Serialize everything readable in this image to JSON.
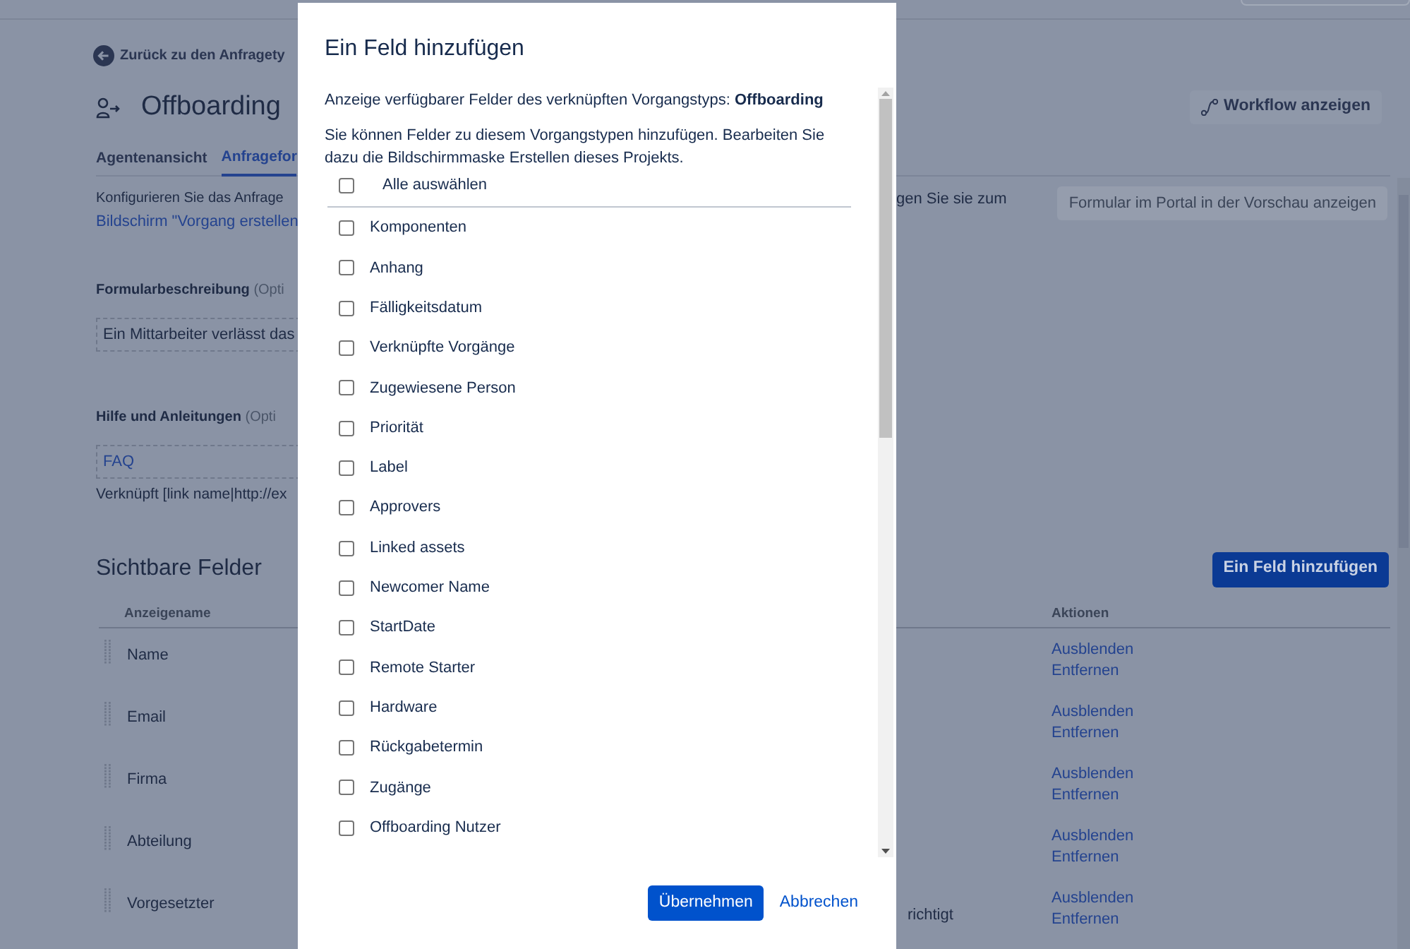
{
  "page": {
    "back_link": "Zurück zu den Anfragety",
    "title": "Offboarding",
    "workflow_button": "Workflow anzeigen",
    "tabs": [
      {
        "label": "Agentenansicht",
        "selected": false
      },
      {
        "label": "Anfragefor",
        "selected": true
      }
    ],
    "intro": {
      "text": "Konfigurieren Sie das Anfrage",
      "link": "Bildschirm \"Vorgang erstellen",
      "continuation": "gen Sie sie zum"
    },
    "preview_button": "Formular im Portal in der Vorschau anzeigen",
    "form_description": {
      "label": "Formularbeschreibung",
      "hint": "(Opti",
      "value": "Ein Mittarbeiter verlässt das"
    },
    "help": {
      "label": "Hilfe und Anleitungen",
      "hint": "(Opti",
      "value": "FAQ",
      "note": "Verknüpft [link name|http://ex"
    },
    "visible_fields": {
      "title": "Sichtbare Felder",
      "add_button": "Ein Feld hinzufügen",
      "columns": [
        "Anzeigename",
        "Aktionen"
      ],
      "rows": [
        {
          "name": "Name",
          "actions": [
            "Ausblenden",
            "Entfernen"
          ]
        },
        {
          "name": "Email",
          "actions": [
            "Ausblenden",
            "Entfernen"
          ]
        },
        {
          "name": "Firma",
          "actions": [
            "Ausblenden",
            "Entfernen"
          ]
        },
        {
          "name": "Abteilung",
          "actions": [
            "Ausblenden",
            "Entfernen"
          ]
        },
        {
          "name": "Vorgesetzter",
          "column_2": "richtigt",
          "actions": [
            "Ausblenden",
            "Entfernen"
          ]
        }
      ]
    }
  },
  "dialog": {
    "title": "Ein Feld hinzufügen",
    "info": "Anzeige verfügbarer Felder des verknüpften Vorgangstyps: **Offboarding**",
    "hint": "Sie können Felder zu diesem Vorgangstypen hinzufügen. Bearbeiten Sie dazu die Bildschirmmaske Erstellen dieses Projekts.",
    "select_all": {
      "label": "Alle auswählen",
      "checked": false
    },
    "fields": [
      {
        "label": "Komponenten",
        "checked": false
      },
      {
        "label": "Anhang",
        "checked": false
      },
      {
        "label": "Fälligkeitsdatum",
        "checked": false
      },
      {
        "label": "Verknüpfte Vorgänge",
        "checked": false
      },
      {
        "label": "Zugewiesene Person",
        "checked": false
      },
      {
        "label": "Priorität",
        "checked": false
      },
      {
        "label": "Label",
        "checked": false
      },
      {
        "label": "Approvers",
        "checked": false
      },
      {
        "label": "Linked assets",
        "checked": false
      },
      {
        "label": "Newcomer Name",
        "checked": false
      },
      {
        "label": "StartDate",
        "checked": false
      },
      {
        "label": "Remote Starter",
        "checked": false
      },
      {
        "label": "Hardware",
        "checked": false
      },
      {
        "label": "Rückgabetermin",
        "checked": false
      },
      {
        "label": "Zugänge",
        "checked": false
      },
      {
        "label": "Offboarding Nutzer",
        "checked": false
      }
    ],
    "apply_button": "Übernehmen",
    "cancel_button": "Abbrechen"
  }
}
